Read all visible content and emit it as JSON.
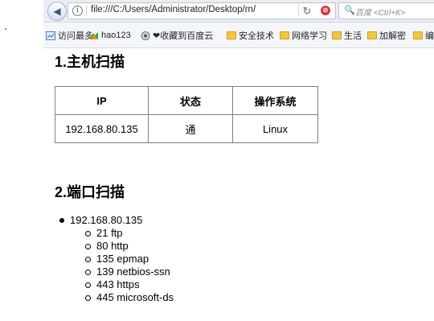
{
  "browser": {
    "url": "file:///C:/Users/Administrator/Desktop/rn/",
    "search_placeholder": "百度 <Ctrl+K>",
    "bookmarks": [
      {
        "label": "访问最多",
        "icon": "frequent-icon"
      },
      {
        "label": "hao123",
        "icon": "hao123-icon"
      },
      {
        "label": "❤收藏到百度云",
        "icon": "baidu-cloud-icon"
      },
      {
        "label": "安全技术",
        "icon": "folder-icon"
      },
      {
        "label": "网络学习",
        "icon": "folder-icon"
      },
      {
        "label": "生活",
        "icon": "folder-icon"
      },
      {
        "label": "加解密",
        "icon": "folder-icon"
      },
      {
        "label": "编",
        "icon": "folder-icon"
      }
    ]
  },
  "page": {
    "section1_title": "1.主机扫描",
    "table": {
      "headers": [
        "IP",
        "状态",
        "操作系统"
      ],
      "rows": [
        [
          "192.168.80.135",
          "通",
          "Linux"
        ]
      ]
    },
    "section2_title": "2.端口扫描",
    "host": "192.168.80.135",
    "ports": [
      "21 ftp",
      "80 http",
      "135 epmap",
      "139 netbios-ssn",
      "443 https",
      "445 microsoft-ds"
    ]
  }
}
